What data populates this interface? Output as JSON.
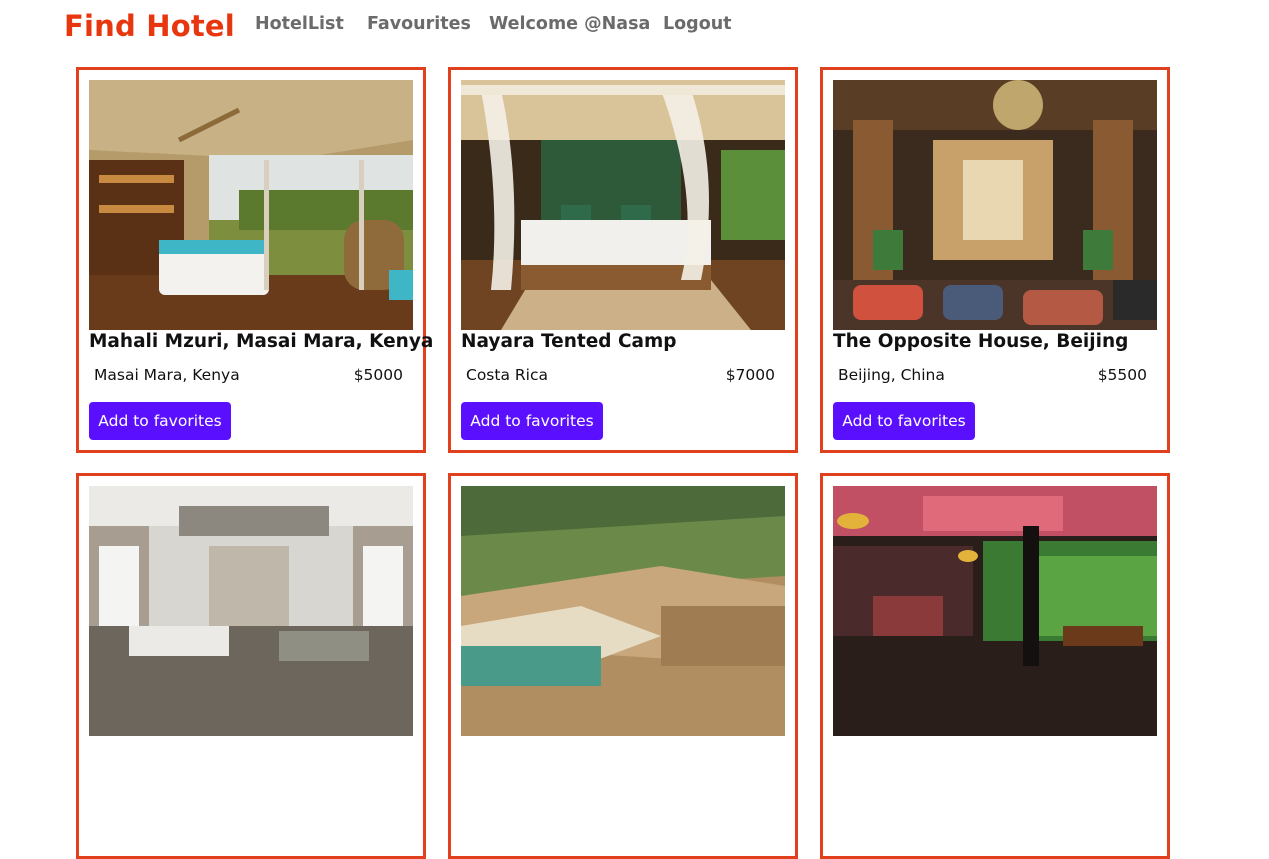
{
  "nav": {
    "brand": "Find Hotel",
    "links": [
      "HotelList",
      "Favourites",
      "Welcome @Nasa",
      "Logout"
    ]
  },
  "hotels": [
    {
      "name": "Mahali Mzuri, Masai Mara, Kenya",
      "location": "Masai Mara, Kenya",
      "price": "$5000",
      "button": "Add to favorites"
    },
    {
      "name": "Nayara Tented Camp",
      "location": "Costa Rica",
      "price": "$7000",
      "button": "Add to favorites"
    },
    {
      "name": "The Opposite House, Beijing",
      "location": "Beijing, China",
      "price": "$5500",
      "button": "Add to favorites"
    },
    {
      "name": "",
      "location": "",
      "price": "",
      "button": ""
    },
    {
      "name": "",
      "location": "",
      "price": "",
      "button": ""
    },
    {
      "name": "",
      "location": "",
      "price": "",
      "button": ""
    }
  ],
  "colors": {
    "brand": "#e8360e",
    "card_border": "#e0401d",
    "button": "#5a10ff",
    "nav_link": "#6b6b6b"
  }
}
